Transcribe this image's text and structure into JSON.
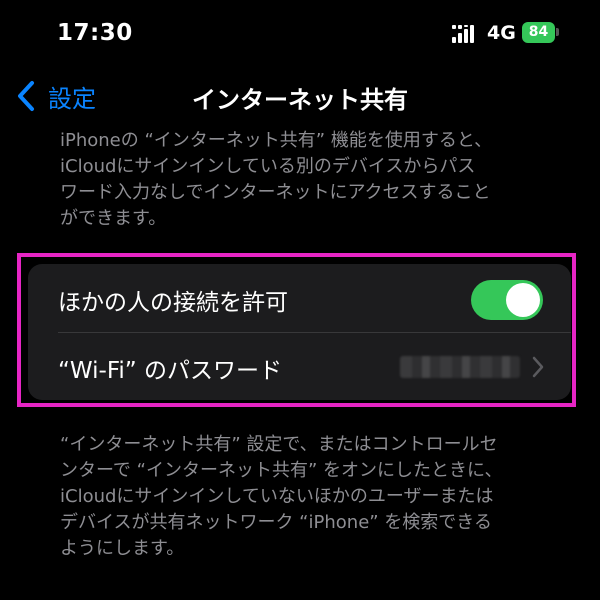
{
  "status_bar": {
    "time": "17:30",
    "network": "4G",
    "battery": "84",
    "signal_icon": "signal-bars-icon",
    "battery_icon": "battery-charging-icon"
  },
  "nav": {
    "back_label": "設定",
    "back_icon": "chevron-left-icon",
    "title": "インターネット共有"
  },
  "description_top": [
    "iPhoneの “インターネット共有” 機能を使用すると、",
    "iCloudにサインインしている別のデバイスからパス",
    "ワード入力なしでインターネットにアクセスすること",
    "ができます。"
  ],
  "settings": {
    "allow_others_label": "ほかの人の接続を許可",
    "allow_others_enabled": true,
    "wifi_password_label": "“Wi-Fi” のパスワード",
    "wifi_password_chevron_icon": "chevron-right-icon"
  },
  "description_bottom": [
    "“インターネット共有” 設定で、またはコントロールセ",
    "ンターで “インターネット共有” をオンにしたときに、",
    "iCloudにサインインしていないほかのユーザーまたは",
    "デバイスが共有ネットワーク “iPhone” を検索できる",
    "ようにします。"
  ],
  "colors": {
    "accent": "#0a84ff",
    "toggle_on": "#35c759",
    "highlight": "#e625c5",
    "background": "#000000",
    "group_background": "#1c1c1e",
    "secondary_text": "#8e8e93"
  }
}
